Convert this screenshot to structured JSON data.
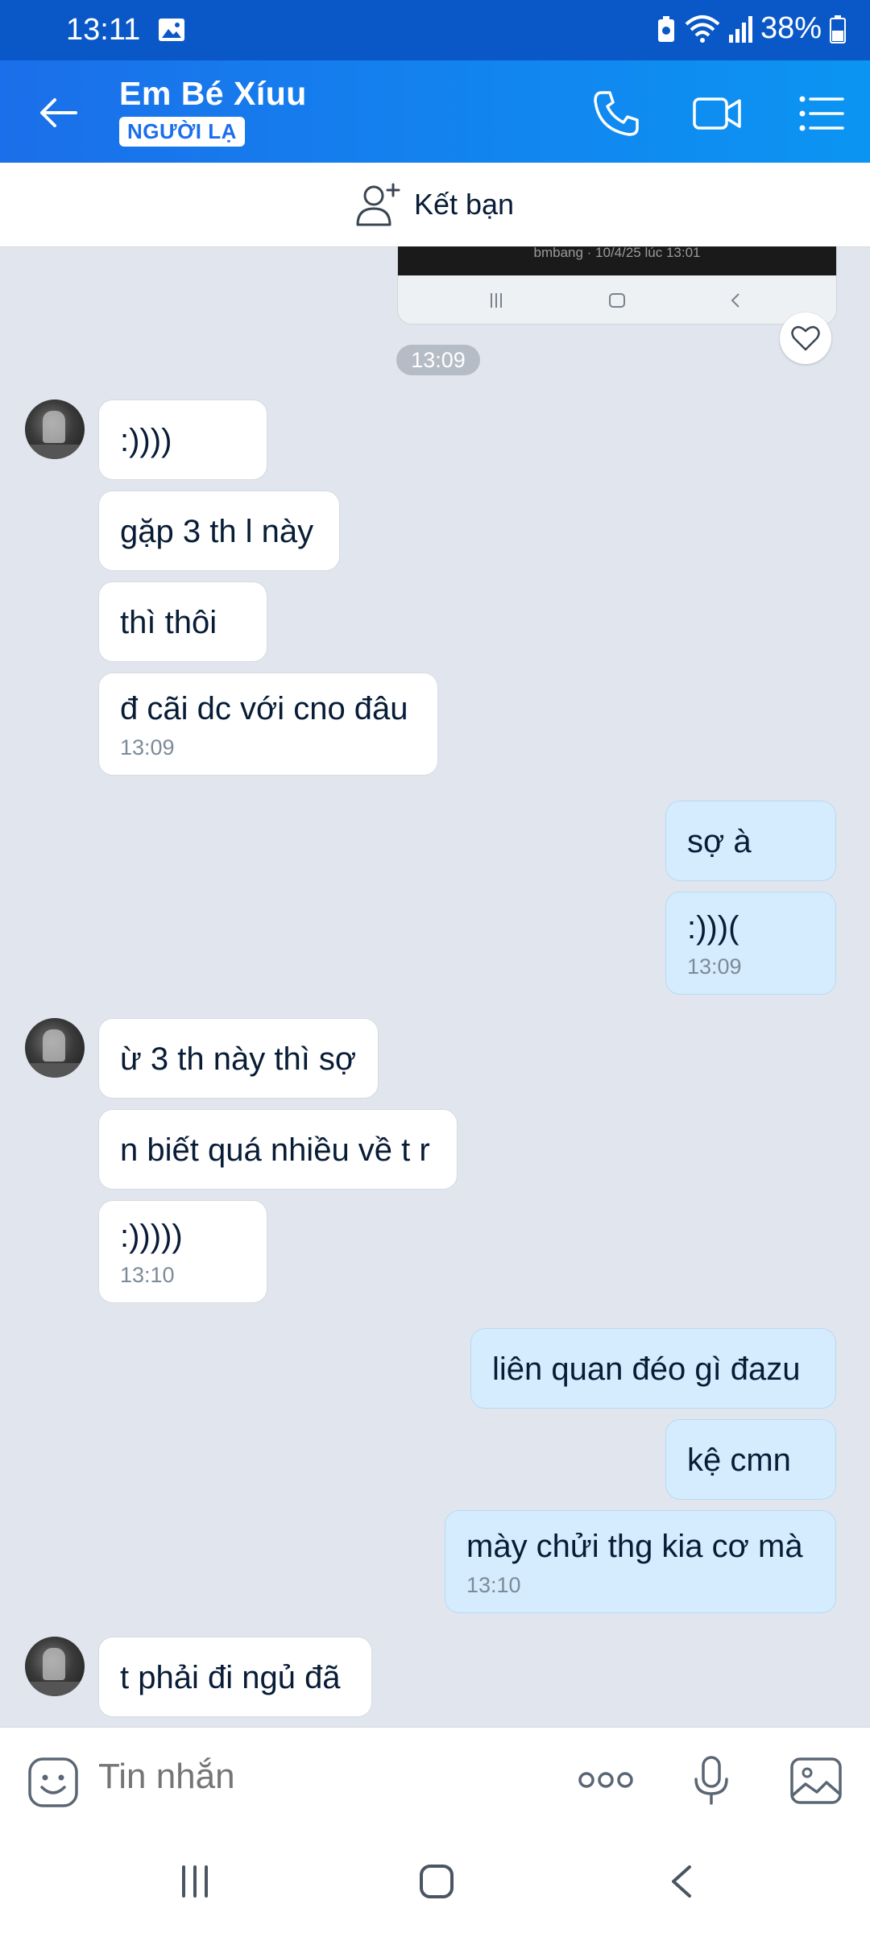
{
  "status_bar": {
    "time": "13:11",
    "battery": "38%"
  },
  "header": {
    "contact_name": "Em Bé Xíuu",
    "badge": "NGƯỜI LẠ"
  },
  "add_friend": {
    "label": "Kết bạn"
  },
  "chat": {
    "image_caption": "bmbang · 10/4/25 lúc 13:01",
    "time_divider": "13:09",
    "messages": [
      {
        "dir": "in",
        "text": ":))))",
        "time": ""
      },
      {
        "dir": "in",
        "text": "gặp 3 th l này",
        "time": ""
      },
      {
        "dir": "in",
        "text": "thì thôi",
        "time": ""
      },
      {
        "dir": "in",
        "text": "đ cãi dc với cno đâu",
        "time": "13:09"
      },
      {
        "dir": "out",
        "text": "sợ à",
        "time": ""
      },
      {
        "dir": "out",
        "text": ":)))(",
        "time": "13:09"
      },
      {
        "dir": "in",
        "text": "ừ 3 th này thì sợ",
        "time": ""
      },
      {
        "dir": "in",
        "text": "n biết quá nhiều về t r",
        "time": ""
      },
      {
        "dir": "in",
        "text": ":)))))",
        "time": "13:10"
      },
      {
        "dir": "out",
        "text": "liên quan đéo gì đazu",
        "time": ""
      },
      {
        "dir": "out",
        "text": "kệ cmn",
        "time": ""
      },
      {
        "dir": "out",
        "text": "mày chửi thg kia cơ mà",
        "time": "13:10"
      },
      {
        "dir": "in",
        "text": "t phải đi ngủ đã",
        "time": ""
      }
    ]
  },
  "composer": {
    "placeholder": "Tin nhắn"
  },
  "colors": {
    "header_start": "#1b6fea",
    "header_end": "#0b95f2",
    "status_bar": "#0a58c8",
    "outgoing_bubble": "#d4ecfd",
    "chat_bg": "#e1e6ee"
  }
}
